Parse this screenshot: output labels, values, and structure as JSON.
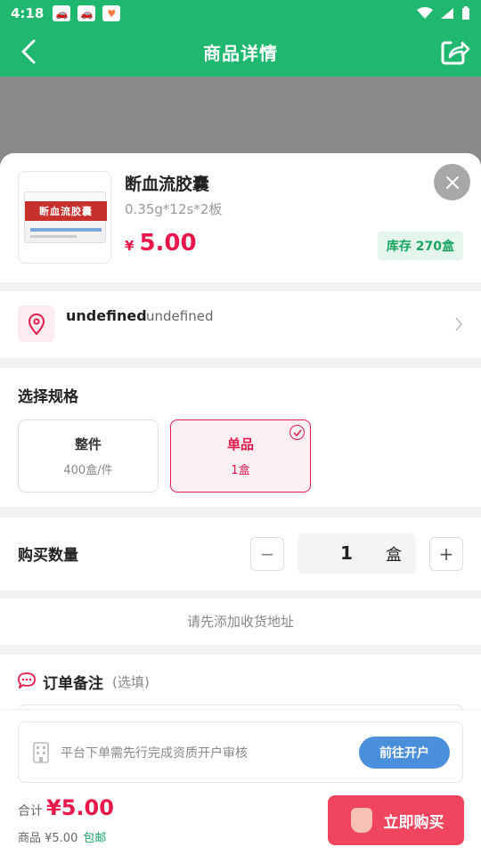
{
  "status": {
    "time": "4:18"
  },
  "nav": {
    "title": "商品详情"
  },
  "product": {
    "name": "断血流胶囊",
    "spec": "0.35g*12s*2板",
    "currency": "¥",
    "price": "5.00",
    "stock": "库存 270盒",
    "box_text": "断血流胶囊"
  },
  "address": {
    "name": "undefined",
    "detail": "undefined"
  },
  "spec_section": {
    "title": "选择规格",
    "options": [
      {
        "label": "整件",
        "sub": "400盒/件",
        "selected": false
      },
      {
        "label": "单品",
        "sub": "1盒",
        "selected": true
      }
    ]
  },
  "quantity": {
    "label": "购买数量",
    "value": "1",
    "unit": "盒",
    "minus": "−",
    "plus": "+"
  },
  "hint": "请先添加收货地址",
  "remark": {
    "title": "订单备注",
    "optional": "(选填)"
  },
  "notice": {
    "text": "平台下单需先行完成资质开户审核",
    "button": "前往开户"
  },
  "footer": {
    "total_label": "合计",
    "total_value": "¥5.00",
    "goods_line": "商品 ¥5.00",
    "shipping": "包邮",
    "buy_button": "立即购买"
  },
  "colors": {
    "brand_green": "#1fb86e",
    "accent_red": "#e8194a",
    "blue": "#4a8fdb"
  }
}
